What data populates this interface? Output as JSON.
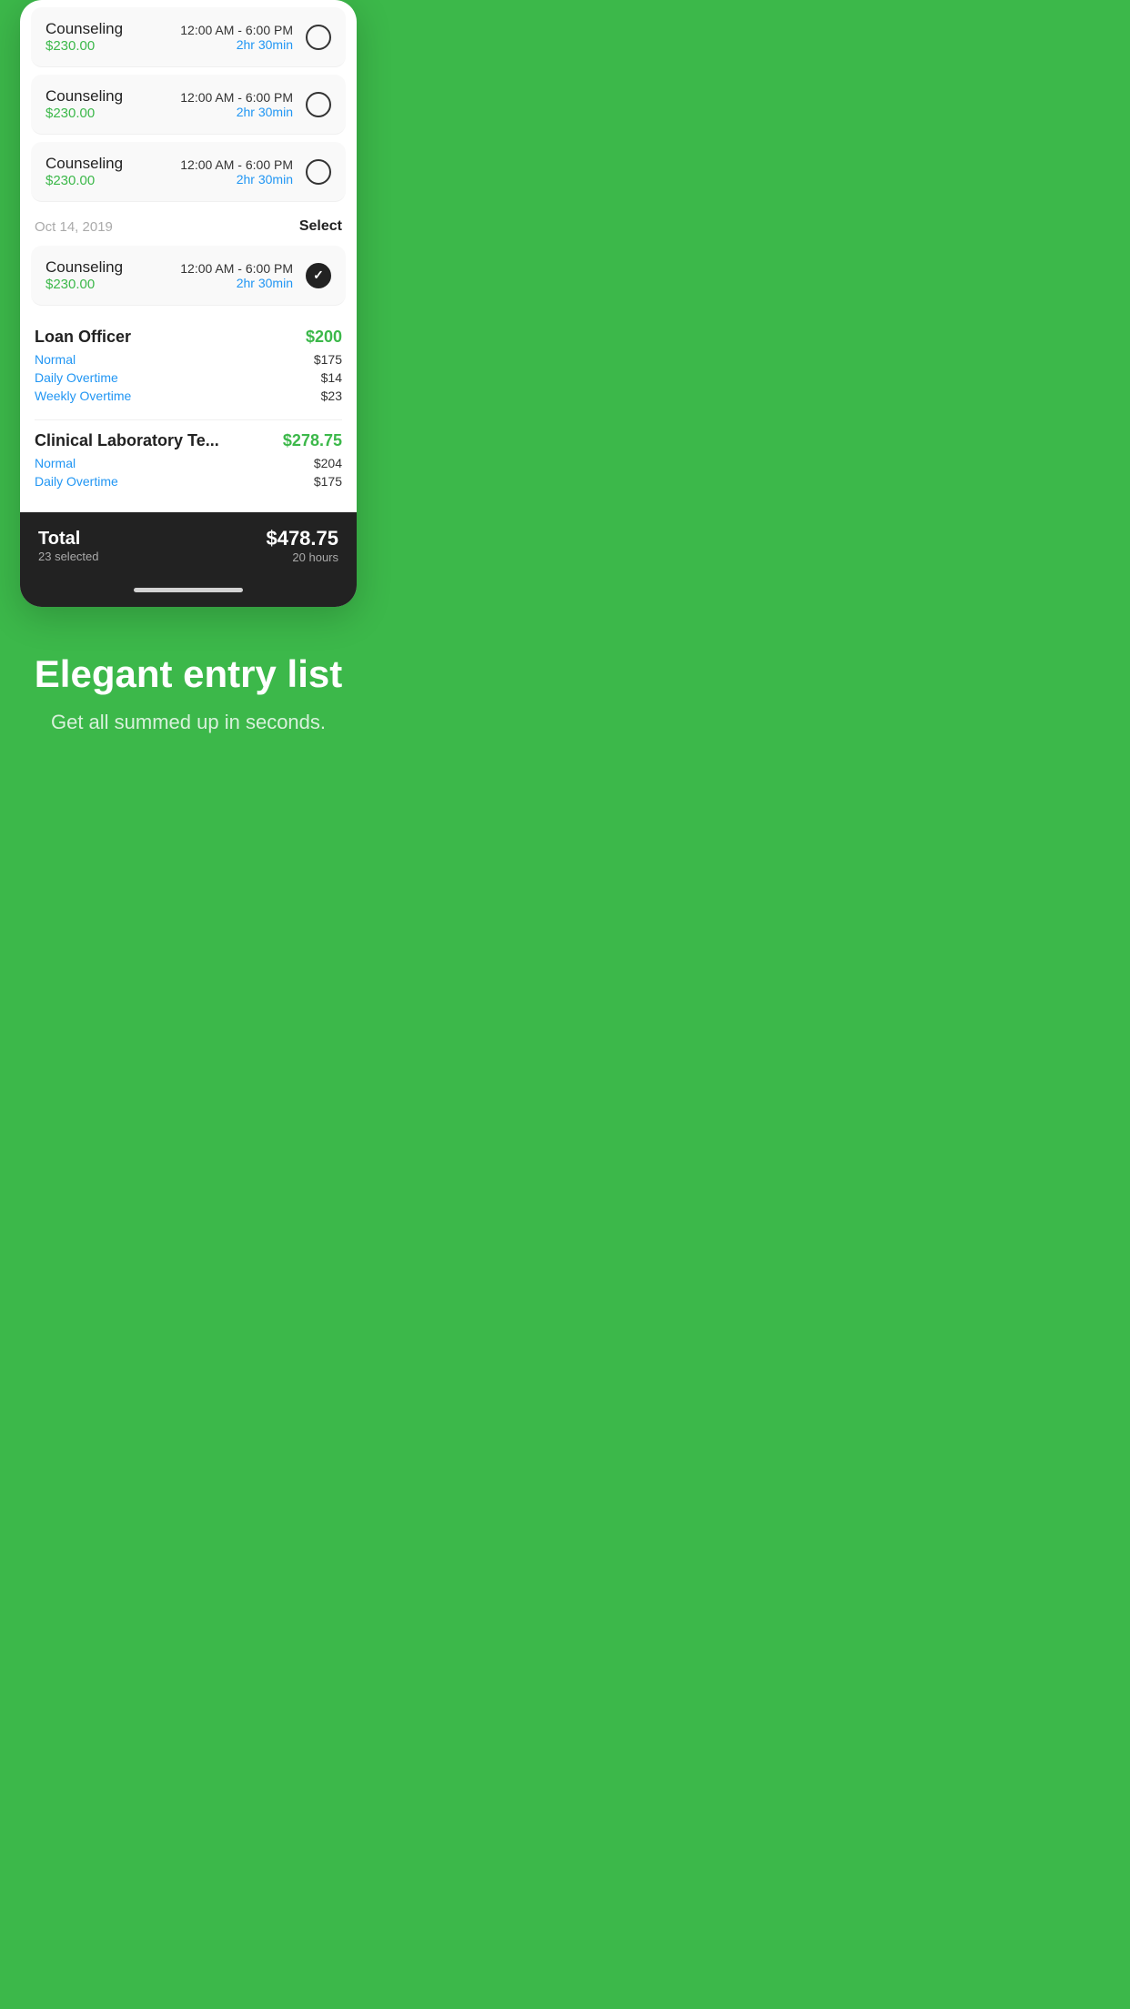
{
  "background_color": "#3cb84a",
  "phone_card": {
    "entry_rows": [
      {
        "id": "row-1",
        "title": "Counseling",
        "price": "$230.00",
        "time_range": "12:00 AM - 6:00 PM",
        "duration": "2hr 30min",
        "selected": false
      },
      {
        "id": "row-2",
        "title": "Counseling",
        "price": "$230.00",
        "time_range": "12:00 AM - 6:00 PM",
        "duration": "2hr 30min",
        "selected": false
      },
      {
        "id": "row-3",
        "title": "Counseling",
        "price": "$230.00",
        "time_range": "12:00 AM - 6:00 PM",
        "duration": "2hr 30min",
        "selected": false
      }
    ],
    "section_date": "Oct 14, 2019",
    "section_select_label": "Select",
    "selected_entry": {
      "title": "Counseling",
      "price": "$230.00",
      "time_range": "12:00 AM - 6:00 PM",
      "duration": "2hr 30min",
      "selected": true
    },
    "summary_items": [
      {
        "title": "Loan Officer",
        "total": "$200",
        "details": [
          {
            "label": "Normal",
            "value": "$175"
          },
          {
            "label": "Daily Overtime",
            "value": "$14"
          },
          {
            "label": "Weekly Overtime",
            "value": "$23"
          }
        ]
      },
      {
        "title": "Clinical Laboratory Te...",
        "total": "$278.75",
        "details": [
          {
            "label": "Normal",
            "value": "$204"
          },
          {
            "label": "Daily Overtime",
            "value": "$175"
          }
        ]
      }
    ],
    "bottom_bar": {
      "total_label": "Total",
      "selected_count": "23 selected",
      "total_amount": "$478.75",
      "total_hours": "20 hours"
    }
  },
  "promo": {
    "title": "Elegant entry list",
    "subtitle": "Get all summed up in seconds."
  }
}
